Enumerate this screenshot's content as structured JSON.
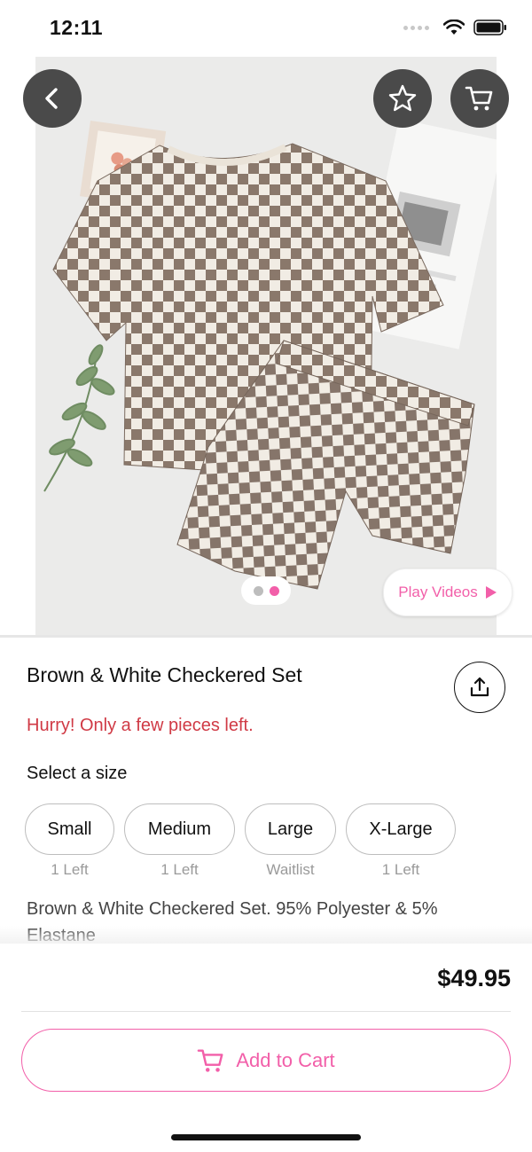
{
  "status_bar": {
    "time": "12:11"
  },
  "hero": {
    "pager_total": 2,
    "pager_active": 2,
    "play_videos_label": "Play Videos"
  },
  "product": {
    "title": "Brown & White Checkered Set",
    "stock_warning": "Hurry! Only a few pieces left.",
    "size_prompt": "Select a size",
    "sizes": [
      {
        "label": "Small",
        "stock": "1 Left"
      },
      {
        "label": "Medium",
        "stock": "1 Left"
      },
      {
        "label": "Large",
        "stock": "Waitlist"
      },
      {
        "label": "X-Large",
        "stock": "1 Left"
      }
    ],
    "description": "Brown & White Checkered Set. 95% Polyester & 5% Elastane"
  },
  "checkout": {
    "price": "$49.95",
    "add_to_cart_label": "Add to Cart"
  },
  "colors": {
    "accent_pink": "#f25fa9",
    "warning_red": "#d03a45",
    "checker_brown": "#8a786b",
    "checker_cream": "#f1ece4",
    "icon_button_bg": "#4a4a4a"
  },
  "icons": {
    "back": "chevron-left-icon",
    "favorite": "star-icon",
    "cart": "cart-icon",
    "share": "share-icon",
    "play": "play-icon"
  }
}
